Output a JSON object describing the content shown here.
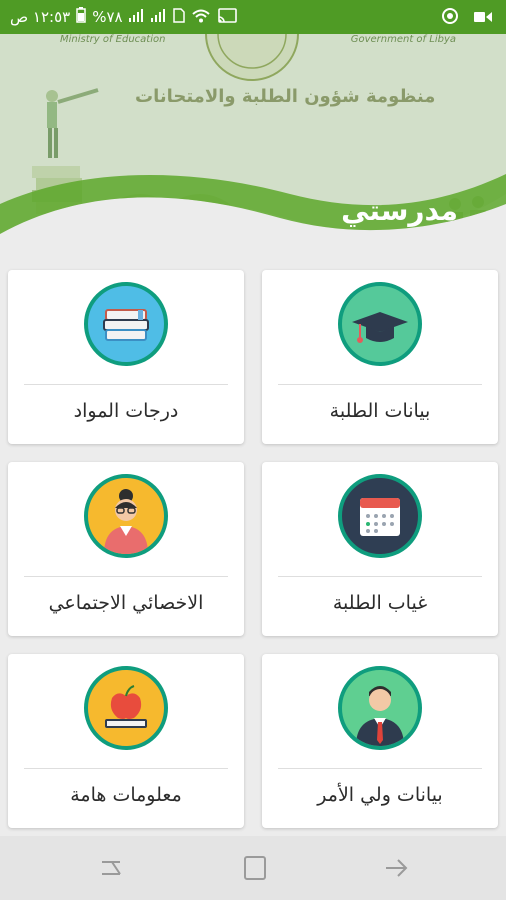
{
  "status_bar": {
    "time": "١٢:٥٣ ص",
    "battery": "%٧٨",
    "icons": [
      "cast-icon",
      "wifi-icon",
      "signal-icon",
      "signal-icon",
      "battery-icon",
      "video-icon",
      "notification-icon"
    ]
  },
  "header": {
    "subtitle_left": "Ministry of Education",
    "subtitle_right": "Government of Libya",
    "caption": "منظومة شؤون الطلبة والامتحانات",
    "app_title": "مدرستي"
  },
  "cards": [
    {
      "label": "بيانات الطلبة",
      "icon": "graduation-cap-icon"
    },
    {
      "label": "درجات المواد",
      "icon": "books-icon"
    },
    {
      "label": "غياب الطلبة",
      "icon": "calendar-icon"
    },
    {
      "label": "الاخصائي الاجتماعي",
      "icon": "social-worker-icon"
    },
    {
      "label": "بيانات ولي الأمر",
      "icon": "guardian-icon"
    },
    {
      "label": "معلومات هامة",
      "icon": "apple-books-icon"
    }
  ],
  "navigation": [
    "recent-apps-icon",
    "home-icon",
    "back-icon"
  ],
  "colors": {
    "primary": "#4f9b25",
    "accent": "#0f9d7e",
    "icon_bg": "#52c0e8"
  }
}
